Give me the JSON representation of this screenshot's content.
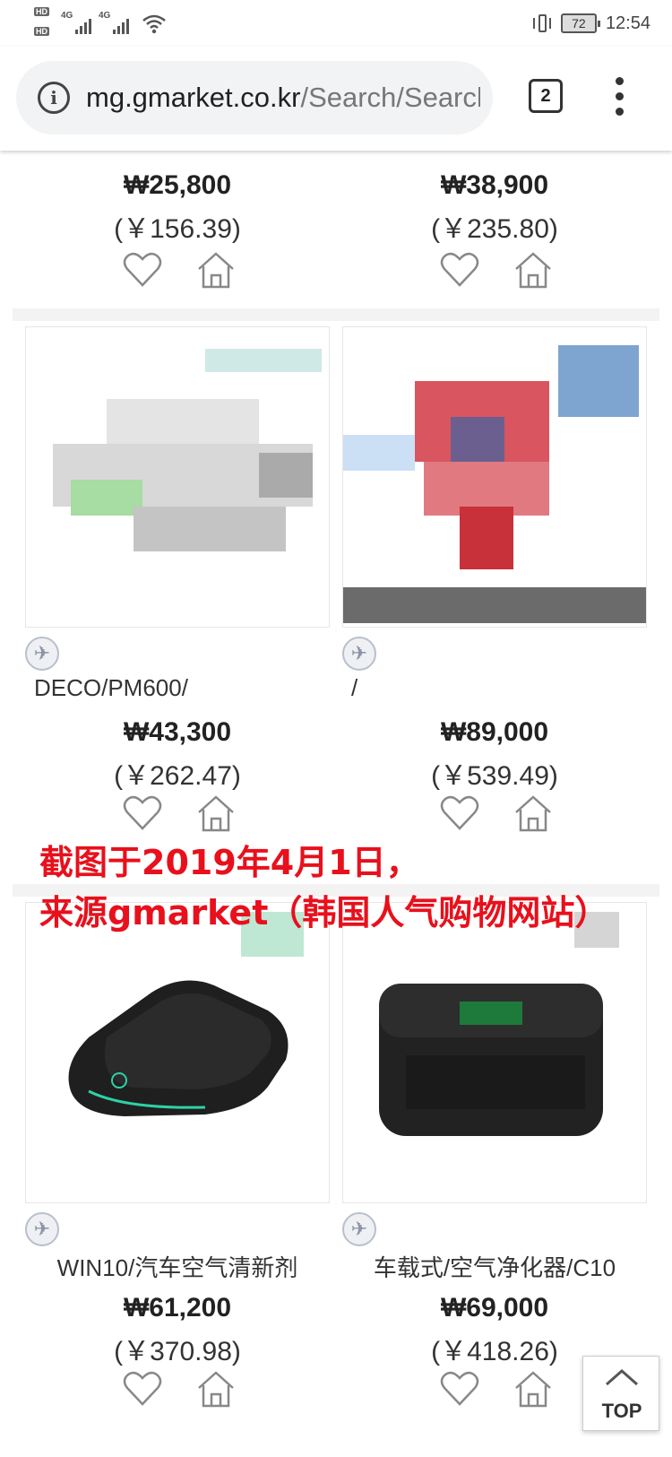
{
  "status_bar": {
    "time": "12:54",
    "battery": "72",
    "network_1": "4G",
    "network_2": "4G"
  },
  "browser": {
    "url_host": "mg.gmarket.co.kr",
    "url_path": "/Search/Search",
    "tab_count": "2"
  },
  "products": [
    {
      "title": "",
      "price": "₩25,800",
      "cny": "(￥156.39)"
    },
    {
      "title": "",
      "price": "₩38,900",
      "cny": "(￥235.80)"
    },
    {
      "title": "DECO/PM600/",
      "price": "₩43,300",
      "cny": "(￥262.47)"
    },
    {
      "title": "/",
      "price": "₩89,000",
      "cny": "(￥539.49)"
    },
    {
      "title": "WIN10/汽车空气清新剂",
      "price": "₩61,200",
      "cny": "(￥370.98)"
    },
    {
      "title": "车载式/空气净化器/C10",
      "price": "₩69,000",
      "cny": "(￥418.26)"
    }
  ],
  "caption": {
    "line1": "截图于2019年4月1日，",
    "line2": "来源gmarket（韩国人气购物网站）"
  },
  "top_button": "TOP",
  "colors": {
    "caption": "#e8101c",
    "omnibox": "#f1f3f4"
  }
}
